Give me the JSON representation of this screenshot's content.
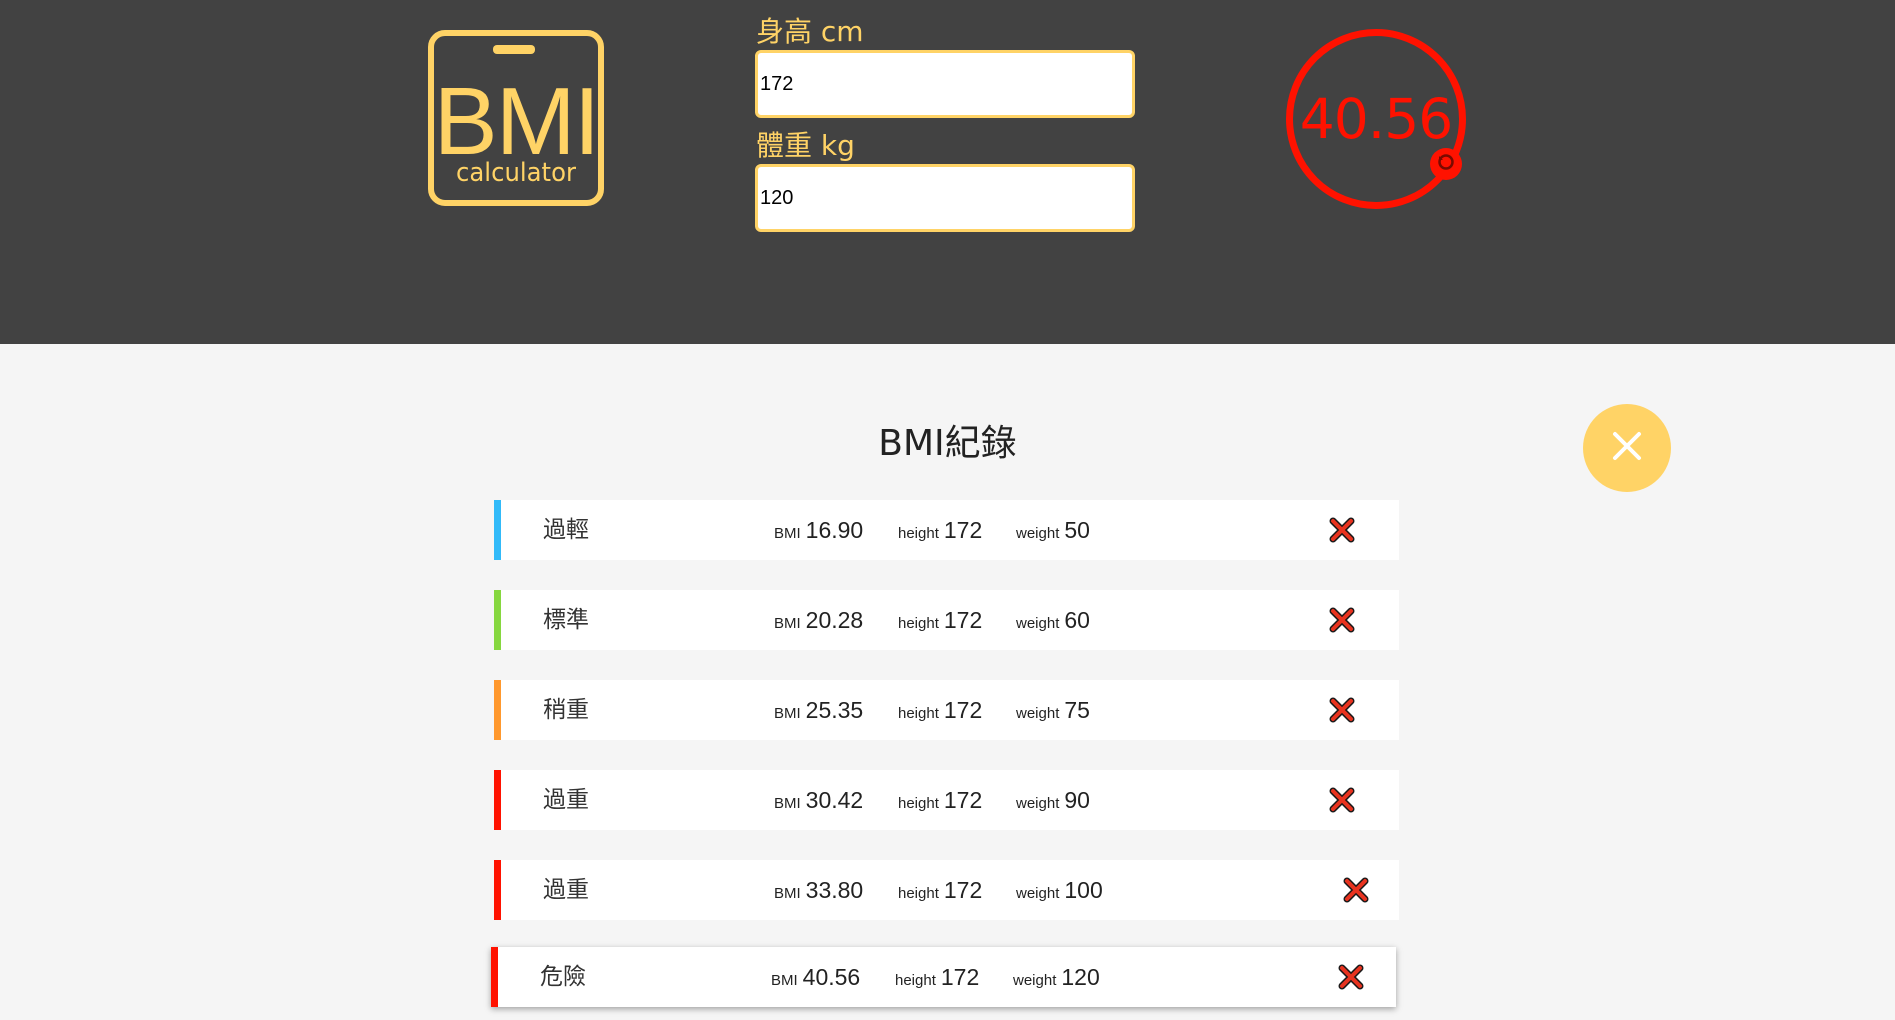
{
  "form": {
    "height_label": "身高 cm",
    "height_value": "172",
    "weight_label": "體重 kg",
    "weight_value": "120"
  },
  "logo": {
    "text_main": "BMI",
    "text_sub": "calculator"
  },
  "result": {
    "value": "40.56",
    "color": "#ff1200"
  },
  "records": {
    "title": "BMI紀錄",
    "metric_keys": {
      "bmi": "BMI",
      "height": "height",
      "weight": "weight"
    },
    "items": [
      {
        "status": "過輕",
        "bmi": "16.90",
        "height": "172",
        "weight": "50",
        "color": "#31baf9"
      },
      {
        "status": "標準",
        "bmi": "20.28",
        "height": "172",
        "weight": "60",
        "color": "#86d73f"
      },
      {
        "status": "稍重",
        "bmi": "25.35",
        "height": "172",
        "weight": "75",
        "color": "#ff982d"
      },
      {
        "status": "過重",
        "bmi": "30.42",
        "height": "172",
        "weight": "90",
        "color": "#ff1200"
      },
      {
        "status": "過重",
        "bmi": "33.80",
        "height": "172",
        "weight": "100",
        "color": "#ff1200"
      },
      {
        "status": "危險",
        "bmi": "40.56",
        "height": "172",
        "weight": "120",
        "color": "#ff1200"
      }
    ]
  },
  "colors": {
    "header_bg": "#424242",
    "accent": "#ffd366",
    "page_bg": "#f5f5f5"
  },
  "icons": {
    "close": "close-icon",
    "delete": "delete-x-icon",
    "reset": "reset-icon"
  }
}
